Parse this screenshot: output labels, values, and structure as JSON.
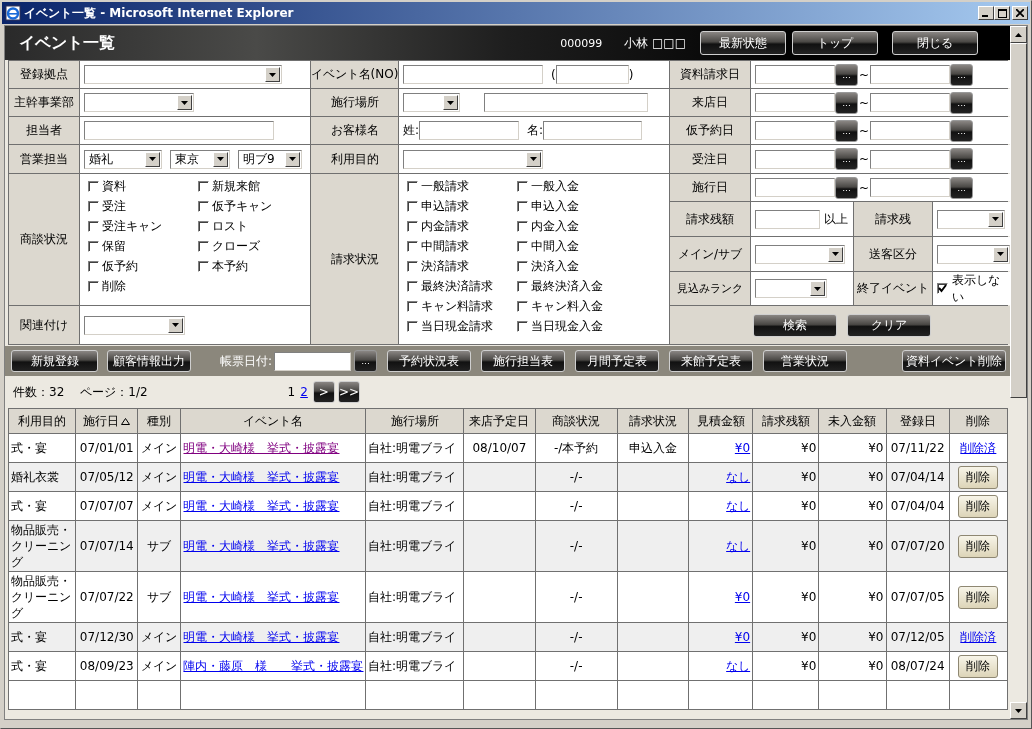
{
  "window": {
    "title": "イベント一覧 - Microsoft Internet Explorer"
  },
  "header": {
    "title": "イベント一覧",
    "user_code": "000099",
    "user_name": "小林 □□□",
    "buttons": [
      "最新状態",
      "トップ",
      "閉じる"
    ]
  },
  "search_form": {
    "registration_base": {
      "label": "登録拠点"
    },
    "department": {
      "label": "主幹事業部"
    },
    "staff": {
      "label": "担当者"
    },
    "sales_staff": {
      "label": "営業担当",
      "values": [
        "婚礼",
        "東京",
        "明ブ9"
      ]
    },
    "negotiation_status": {
      "label": "商談状況",
      "options": [
        {
          "label": "資料",
          "checked": false
        },
        {
          "label": "新規来館",
          "checked": false
        },
        {
          "label": "受注",
          "checked": false
        },
        {
          "label": "仮予キャン",
          "checked": false
        },
        {
          "label": "受注キャン",
          "checked": false
        },
        {
          "label": "ロスト",
          "checked": false
        },
        {
          "label": "保留",
          "checked": false
        },
        {
          "label": "クローズ",
          "checked": false
        },
        {
          "label": "仮予約",
          "checked": false
        },
        {
          "label": "本予約",
          "checked": false
        },
        {
          "label": "削除",
          "checked": false
        }
      ]
    },
    "association": {
      "label": "関連付け"
    },
    "event_name": {
      "label": "イベント名(NO)",
      "open": "(",
      "close": ")"
    },
    "venue": {
      "label": "施行場所"
    },
    "customer_name": {
      "label": "お客様名",
      "surname_label": "姓:",
      "given_label": "名:"
    },
    "purpose": {
      "label": "利用目的"
    },
    "billing_status": {
      "label": "請求状況",
      "options": [
        {
          "label": "一般請求",
          "checked": false
        },
        {
          "label": "一般入金",
          "checked": false
        },
        {
          "label": "申込請求",
          "checked": false
        },
        {
          "label": "申込入金",
          "checked": false
        },
        {
          "label": "内金請求",
          "checked": false
        },
        {
          "label": "内金入金",
          "checked": false
        },
        {
          "label": "中間請求",
          "checked": false
        },
        {
          "label": "中間入金",
          "checked": false
        },
        {
          "label": "決済請求",
          "checked": false
        },
        {
          "label": "決済入金",
          "checked": false
        },
        {
          "label": "最終決済請求",
          "checked": false
        },
        {
          "label": "最終決済入金",
          "checked": false
        },
        {
          "label": "キャン料請求",
          "checked": false
        },
        {
          "label": "キャン料入金",
          "checked": false
        },
        {
          "label": "当日現金請求",
          "checked": false
        },
        {
          "label": "当日現金入金",
          "checked": false
        }
      ]
    },
    "date_ranges": [
      {
        "label": "資料請求日",
        "separator": "~",
        "picker": "..."
      },
      {
        "label": "来店日",
        "separator": "~",
        "picker": "..."
      },
      {
        "label": "仮予約日",
        "separator": "~",
        "picker": "..."
      },
      {
        "label": "受注日",
        "separator": "~",
        "picker": "..."
      },
      {
        "label": "施行日",
        "separator": "~",
        "picker": "..."
      }
    ],
    "balance": {
      "label": "請求残額",
      "suffix": "以上"
    },
    "balance_flag": {
      "label": "請求残"
    },
    "main_sub": {
      "label": "メイン/サブ"
    },
    "referral": {
      "label": "送客区分"
    },
    "rank": {
      "label": "見込みランク"
    },
    "finished_events": {
      "label": "終了イベント",
      "option": "表示しない",
      "checked": true
    },
    "buttons": [
      "検索",
      "クリア"
    ]
  },
  "toolbar": {
    "left_buttons": [
      "新規登録",
      "顧客情報出力"
    ],
    "date_label": "帳票日付:",
    "picker": "...",
    "report_buttons": [
      "予約状況表",
      "施行担当表",
      "月間予定表",
      "来館予定表",
      "営業状況"
    ],
    "delete_button": "資料イベント削除"
  },
  "pager": {
    "count": "件数：32",
    "page": "ページ：1/2",
    "pages": [
      {
        "label": "1",
        "selected": true
      },
      {
        "label": "2",
        "selected": false
      }
    ],
    "next": ">",
    "last": ">>"
  },
  "table": {
    "columns": [
      {
        "label": "利用目的",
        "sorted": false
      },
      {
        "label": "施行日",
        "sorted": true
      },
      {
        "label": "種別",
        "sorted": false
      },
      {
        "label": "イベント名",
        "sorted": false
      },
      {
        "label": "施行場所",
        "sorted": false
      },
      {
        "label": "来店予定日",
        "sorted": false
      },
      {
        "label": "商談状況",
        "sorted": false
      },
      {
        "label": "請求状況",
        "sorted": false
      },
      {
        "label": "見積金額",
        "sorted": false
      },
      {
        "label": "請求残額",
        "sorted": false
      },
      {
        "label": "未入金額",
        "sorted": false
      },
      {
        "label": "登録日",
        "sorted": false
      },
      {
        "label": "削除",
        "sorted": false
      }
    ],
    "rows": [
      {
        "purpose": "式・宴",
        "date": "07/01/01",
        "type": "メイン",
        "event": "明電・大崎様　挙式・披露宴",
        "visited": true,
        "venue": "自社:明電ブライ",
        "visit_date": "08/10/07",
        "negotiation": "-/本予約",
        "billing": "申込入金",
        "estimate": "¥0",
        "balance": "¥0",
        "unpaid": "¥0",
        "registered": "07/11/22",
        "delete": {
          "kind": "link",
          "label": "削除済"
        }
      },
      {
        "purpose": "婚礼衣裳",
        "date": "07/05/12",
        "type": "メイン",
        "event": "明電・大崎様　挙式・披露宴",
        "visited": false,
        "venue": "自社:明電ブライ",
        "negotiation": "-/-",
        "estimate": "なし",
        "balance": "¥0",
        "unpaid": "¥0",
        "registered": "07/04/14",
        "delete": {
          "kind": "button",
          "label": "削除"
        }
      },
      {
        "purpose": "式・宴",
        "date": "07/07/07",
        "type": "メイン",
        "event": "明電・大崎様　挙式・披露宴",
        "visited": false,
        "venue": "自社:明電ブライ",
        "negotiation": "-/-",
        "estimate": "なし",
        "balance": "¥0",
        "unpaid": "¥0",
        "registered": "07/04/04",
        "delete": {
          "kind": "button",
          "label": "削除"
        }
      },
      {
        "purpose": "物品販売・クリーニング",
        "date": "07/07/14",
        "type": "サブ",
        "event": "明電・大崎様　挙式・披露宴",
        "visited": false,
        "venue": "自社:明電ブライ",
        "negotiation": "-/-",
        "estimate": "なし",
        "balance": "¥0",
        "unpaid": "¥0",
        "registered": "07/07/20",
        "delete": {
          "kind": "button",
          "label": "削除"
        }
      },
      {
        "purpose": "物品販売・クリーニング",
        "date": "07/07/22",
        "type": "サブ",
        "event": "明電・大崎様　挙式・披露宴",
        "visited": false,
        "venue": "自社:明電ブライ",
        "negotiation": "-/-",
        "estimate": "¥0",
        "balance": "¥0",
        "unpaid": "¥0",
        "registered": "07/07/05",
        "delete": {
          "kind": "button",
          "label": "削除"
        }
      },
      {
        "purpose": "式・宴",
        "date": "07/12/30",
        "type": "メイン",
        "event": "明電・大崎様　挙式・披露宴",
        "visited": false,
        "venue": "自社:明電ブライ",
        "negotiation": "-/-",
        "estimate": "¥0",
        "balance": "¥0",
        "unpaid": "¥0",
        "registered": "07/12/05",
        "delete": {
          "kind": "link",
          "label": "削除済"
        }
      },
      {
        "purpose": "式・宴",
        "date": "08/09/23",
        "type": "メイン",
        "event": "陣内・藤原　様　　挙式・披露宴",
        "visited": false,
        "venue": "自社:明電ブライ",
        "negotiation": "-/-",
        "estimate": "なし",
        "balance": "¥0",
        "unpaid": "¥0",
        "registered": "08/07/24",
        "delete": {
          "kind": "button",
          "label": "削除"
        }
      }
    ]
  }
}
